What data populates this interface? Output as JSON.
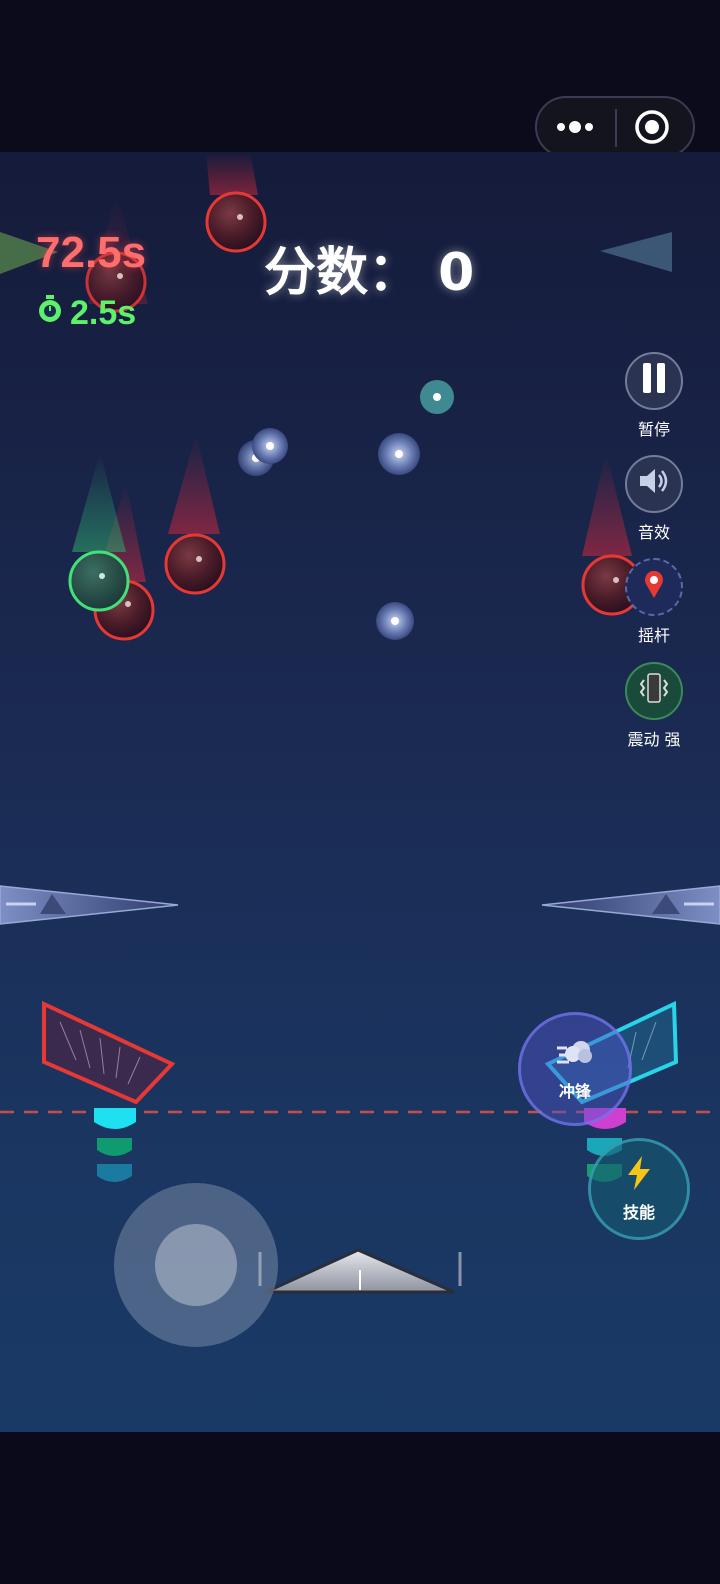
{
  "mini_program": {
    "more_icon": "more-dots-icon",
    "close_icon": "target-circle-icon"
  },
  "hud": {
    "timer_main": "72.5s",
    "timer_sub": "2.5s",
    "timer_sub_icon": "stopwatch-icon",
    "score_text": "分数： 0"
  },
  "controls": [
    {
      "label": "暂停",
      "icon": "pause-icon"
    },
    {
      "label": "音效",
      "icon": "speaker-icon"
    },
    {
      "label": "摇杆",
      "icon": "pin-icon"
    },
    {
      "label": "震动 强",
      "icon": "vibrate-icon"
    }
  ],
  "skills": {
    "charge_label": "冲锋",
    "charge_icon": "dash-icon",
    "skill_label": "技能",
    "skill_icon": "lightning-icon"
  },
  "colors": {
    "enemy_ring": "#e53935",
    "friendly_ring": "#43e07a",
    "timer_main": "#ff6d6d",
    "timer_sub": "#5cf26a",
    "dash_line": "#c0504d"
  }
}
